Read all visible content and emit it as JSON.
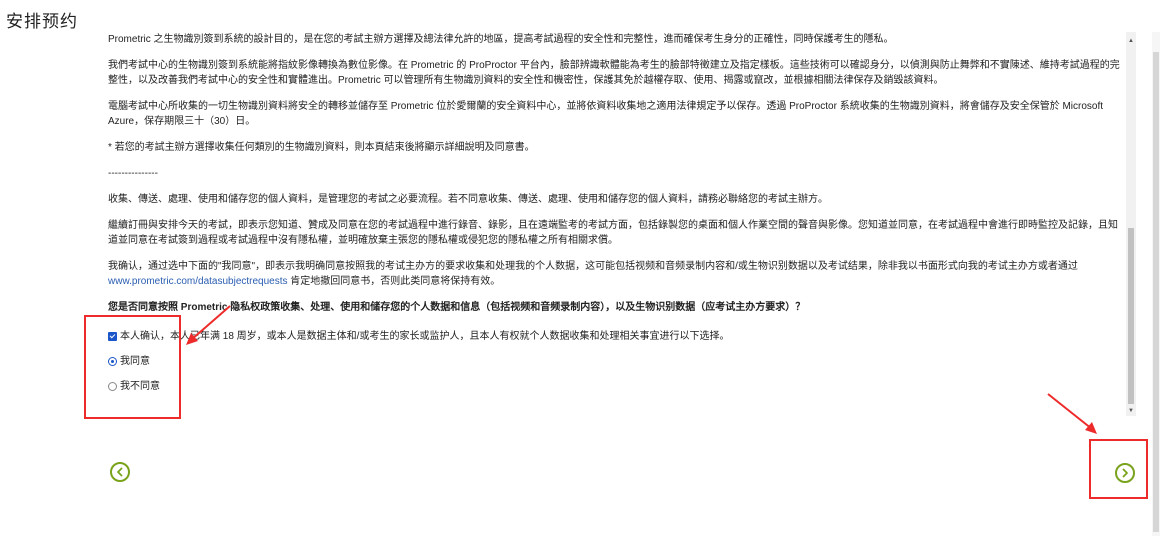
{
  "page": {
    "title": "安排预约"
  },
  "content": {
    "p1": "Prometric 之生物識別簽到系統的設計目的，是在您的考試主辦方選擇及總法律允許的地區，提高考試過程的安全性和完整性，進而確保考生身分的正確性，同時保護考生的隱私。",
    "p2": "我們考試中心的生物識別簽到系統能將指紋影像轉換為數位影像。在 Prometric 的 ProProctor 平台內，臉部辨識軟體能為考生的臉部特徵建立及指定樣板。這些技術可以確認身分，以偵測與防止舞弊和不實陳述、維持考試過程的完整性，以及改善我們考試中心的安全性和實體進出。Prometric 可以管理所有生物識別資料的安全性和機密性，保護其免於越權存取、使用、揭露或竄改，並根據相關法律保存及銷毀該資料。",
    "p3": "電腦考試中心所收集的一切生物識別資料將安全的轉移並儲存至 Prometric 位於愛爾蘭的安全資料中心，並將依資料收集地之適用法律規定予以保存。透過 ProProctor 系統收集的生物識別資料，將會儲存及安全保管於 Microsoft Azure，保存期限三十（30）日。",
    "p4": "* 若您的考試主辦方選擇收集任何類別的生物識別資料，則本頁結束後將顯示詳細說明及同意書。",
    "separator": "---------------",
    "p5": "收集、傳送、處理、使用和儲存您的個人資料，是管理您的考試之必要流程。若不同意收集、傳送、處理、使用和儲存您的個人資料，請務必聯絡您的考試主辦方。",
    "p6": "繼續訂冊與安排今天的考試，即表示您知道、贊成及同意在您的考試過程中進行錄音、錄影，且在遠端監考的考試方面，包括錄製您的桌面和個人作業空間的聲音與影像。您知道並同意，在考試過程中會進行即時監控及記錄，且知道並同意在考試簽到過程或考試過程中沒有隱私權，並明確放棄主張您的隱私權或侵犯您的隱私權之所有相關求償。",
    "p7_before": "我确认，通过选中下面的\"我同意\"，即表示我明确同意按照我的考试主办方的要求收集和处理我的个人数据，这可能包括视频和音频录制内容和/或生物识别数据以及考试结果，除非我以书面形式向我的考试主办方或者通过 ",
    "p7_link": "www.prometric.com/datasubjectrequests",
    "p7_after": " 肯定地撤回同意书，否则此类同意将保持有效。",
    "question": "您是否同意按照 Prometric 隐私权政策收集、处理、使用和储存您的个人数据和信息（包括视频和音频录制内容），以及生物识别数据（应考试主办方要求）？"
  },
  "form": {
    "age_checkbox_label": "本人确认，本人已年满 18 周岁，或本人是数据主体和/或考生的家长或监护人，且本人有权就个人数据收集和处理相关事宜进行以下选择。",
    "age_checked": true,
    "agree_label": "我同意",
    "disagree_label": "我不同意",
    "selected": "agree"
  },
  "navigation": {
    "prev_icon": "chevron-left-icon",
    "next_icon": "chevron-right-icon",
    "accent_color": "#7aa31d"
  },
  "annotations": {
    "color": "#ee2b2b"
  }
}
